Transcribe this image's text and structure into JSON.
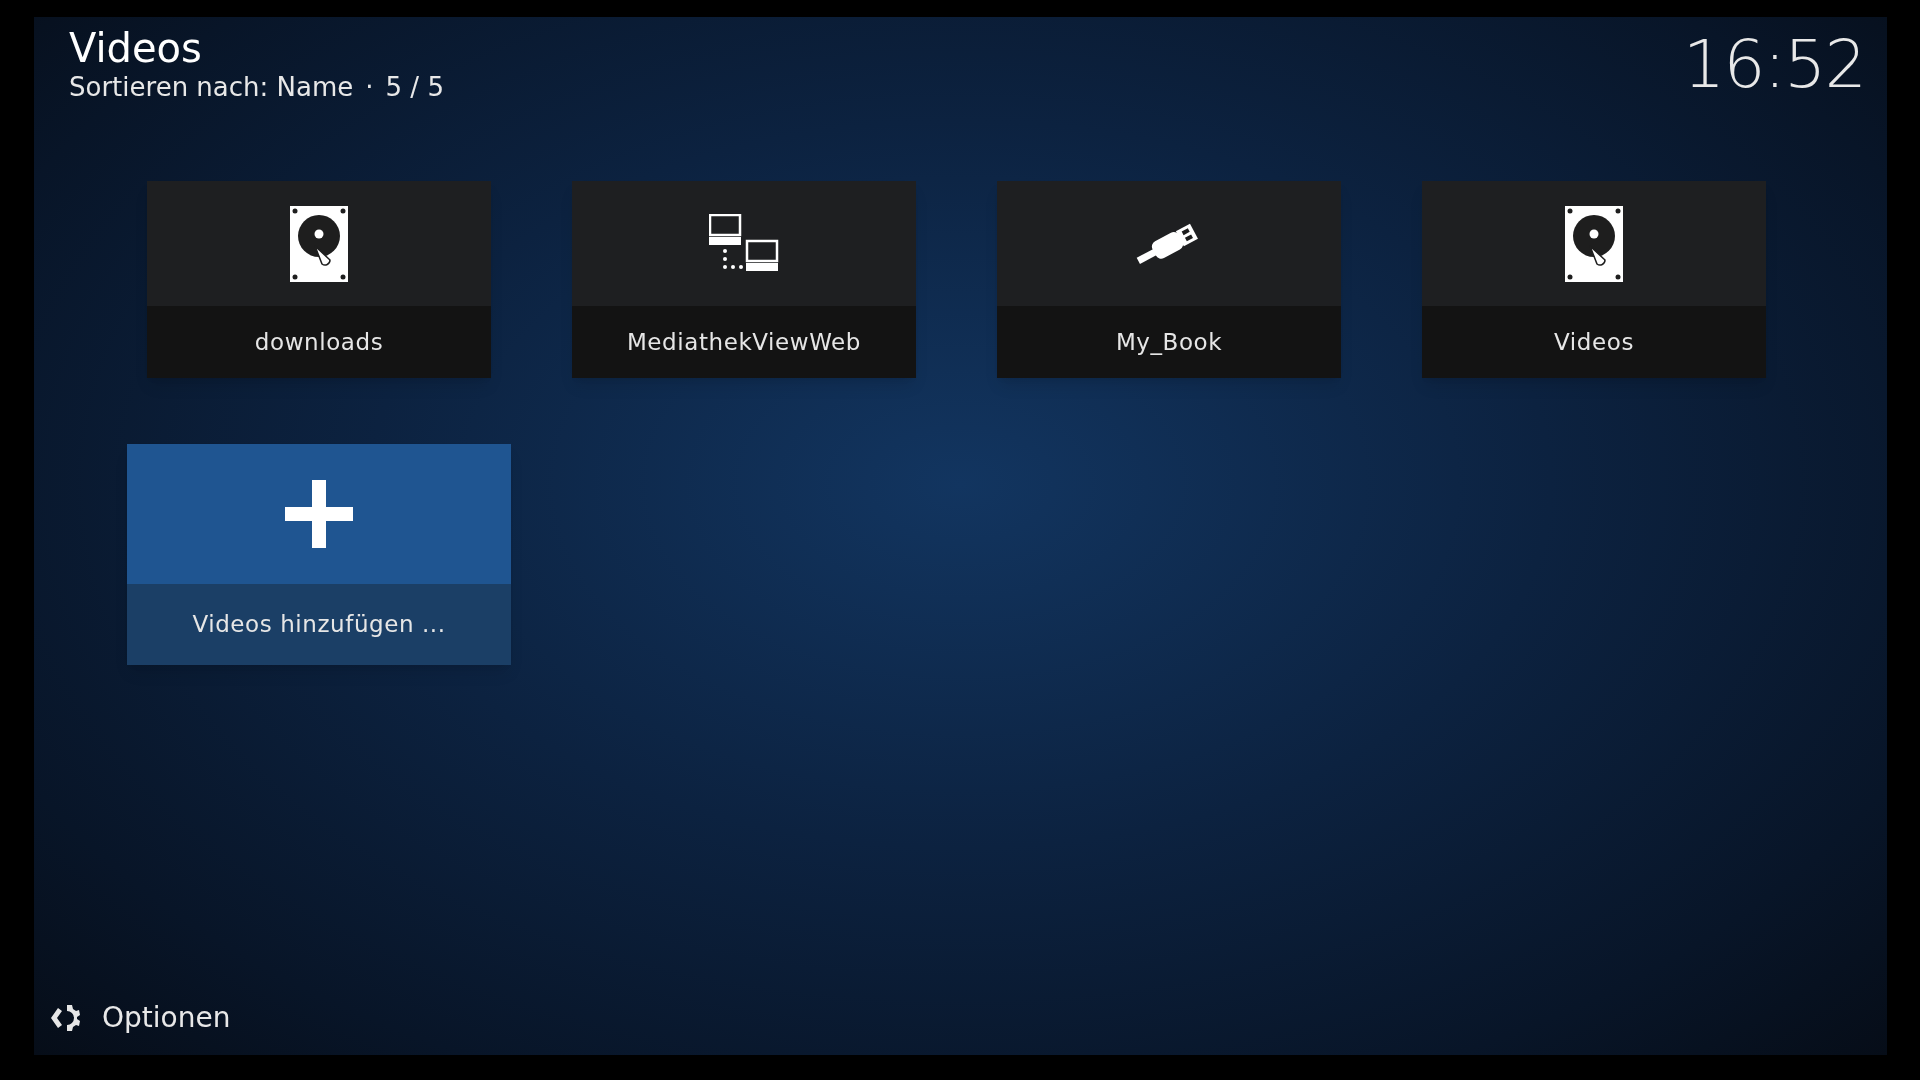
{
  "header": {
    "title": "Videos",
    "sort": "Sortieren nach: Name",
    "separator": "·",
    "count": "5 / 5"
  },
  "clock": "16:52",
  "items": [
    {
      "label": "downloads",
      "kind": "hdd",
      "selected": false
    },
    {
      "label": "MediathekViewWeb",
      "kind": "network",
      "selected": false
    },
    {
      "label": "My_Book",
      "kind": "usb",
      "selected": false
    },
    {
      "label": "Videos",
      "kind": "hdd",
      "selected": false
    },
    {
      "label": "Videos hinzufügen ...",
      "kind": "add",
      "selected": true
    }
  ],
  "footer": {
    "options": "Optionen"
  }
}
